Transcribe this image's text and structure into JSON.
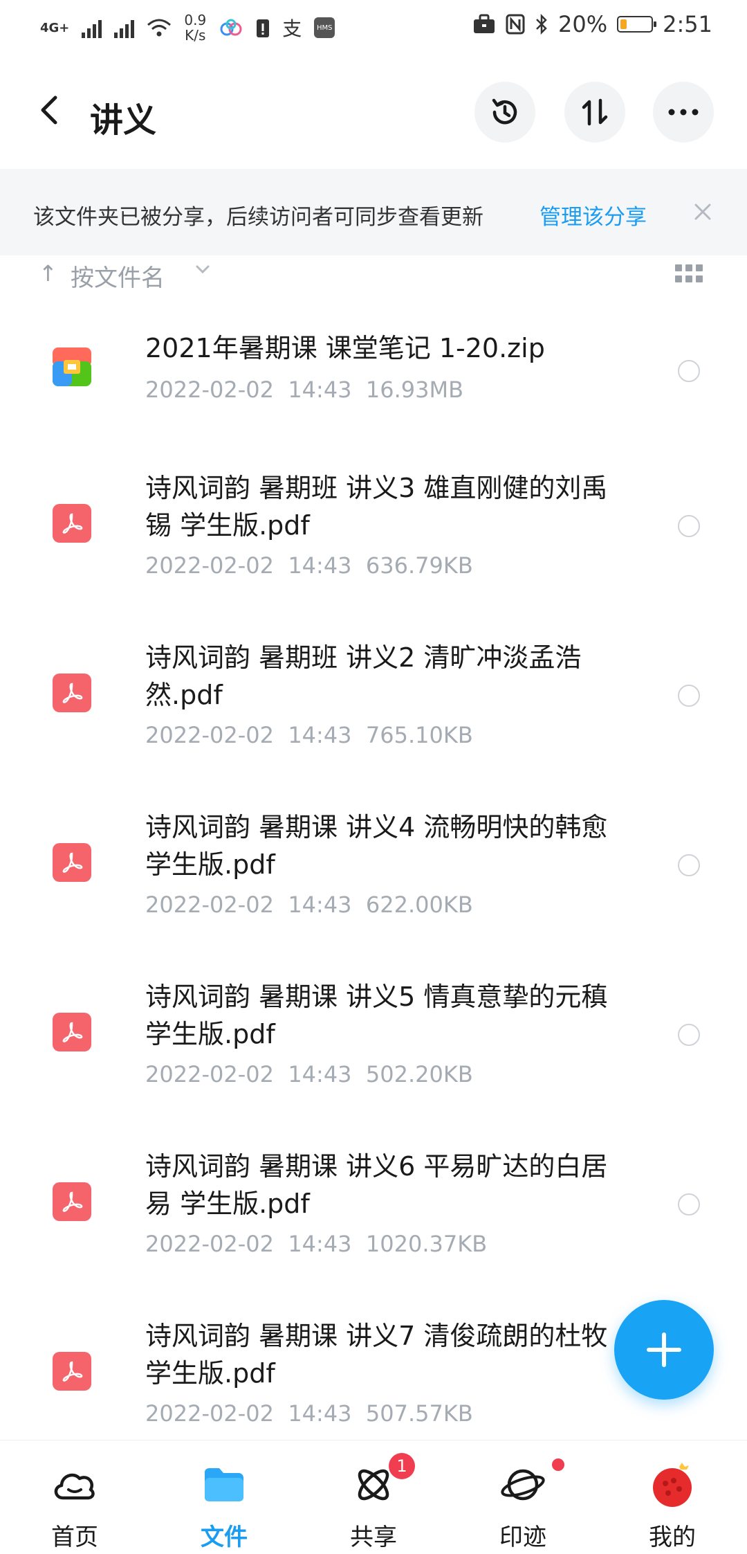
{
  "status_bar": {
    "network": "4G+",
    "speed_value": "0.9",
    "speed_unit": "K/s",
    "battery": "20%",
    "battery_level": 0.2,
    "time": "2:51"
  },
  "header": {
    "title": "讲义"
  },
  "banner": {
    "text": "该文件夹已被分享，后续访问者可同步查看更新",
    "link": "管理该分享"
  },
  "sort": {
    "label": "按文件名"
  },
  "files": [
    {
      "name": "2021年暑期课 课堂笔记 1-20.zip",
      "date": "2022-02-02",
      "time": "14:43",
      "size": "16.93MB",
      "type": "zip"
    },
    {
      "name": "诗风词韵 暑期班  讲义3 雄直刚健的刘禹锡 学生版.pdf",
      "date": "2022-02-02",
      "time": "14:43",
      "size": "636.79KB",
      "type": "pdf"
    },
    {
      "name": "诗风词韵 暑期班 讲义2 清旷冲淡孟浩然.pdf",
      "date": "2022-02-02",
      "time": "14:43",
      "size": "765.10KB",
      "type": "pdf"
    },
    {
      "name": "诗风词韵 暑期课 讲义4 流畅明快的韩愈 学生版.pdf",
      "date": "2022-02-02",
      "time": "14:43",
      "size": "622.00KB",
      "type": "pdf"
    },
    {
      "name": "诗风词韵 暑期课 讲义5 情真意挚的元稹 学生版.pdf",
      "date": "2022-02-02",
      "time": "14:43",
      "size": "502.20KB",
      "type": "pdf"
    },
    {
      "name": "诗风词韵 暑期课 讲义6 平易旷达的白居易 学生版.pdf",
      "date": "2022-02-02",
      "time": "14:43",
      "size": "1020.37KB",
      "type": "pdf"
    },
    {
      "name": "诗风词韵 暑期课 讲义7 清俊疏朗的杜牧 学生版.pdf",
      "date": "2022-02-02",
      "time": "14:43",
      "size": "507.57KB",
      "type": "pdf"
    }
  ],
  "bottom_nav": [
    {
      "label": "首页",
      "icon": "cloud-icon",
      "active": false
    },
    {
      "label": "文件",
      "icon": "folder-icon",
      "active": true
    },
    {
      "label": "共享",
      "icon": "atom-icon",
      "active": false,
      "badge": "1"
    },
    {
      "label": "印迹",
      "icon": "planet-icon",
      "active": false
    },
    {
      "label": "我的",
      "icon": "avatar",
      "active": false
    }
  ],
  "colors": {
    "accent": "#1a9cf0",
    "pdf": "#f5636b",
    "badge": "#f03d4f"
  }
}
